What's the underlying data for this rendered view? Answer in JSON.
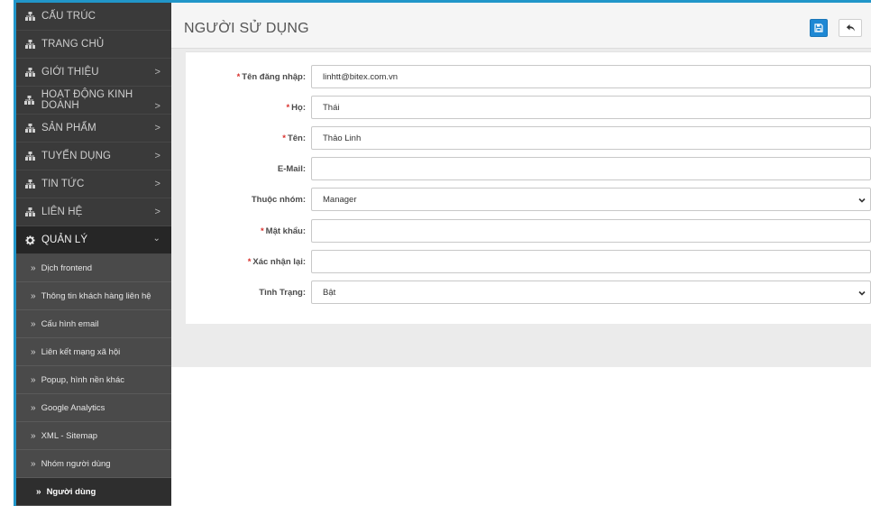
{
  "sidebar": {
    "items": [
      {
        "label": "CẤU TRÚC",
        "chevron": ""
      },
      {
        "label": "TRANG CHỦ",
        "chevron": ""
      },
      {
        "label": "GIỚI THIỆU",
        "chevron": ">"
      },
      {
        "label": "HOẠT ĐỘNG KINH DOANH",
        "chevron": ">"
      },
      {
        "label": "SẢN PHẨM",
        "chevron": ">"
      },
      {
        "label": "TUYỂN DỤNG",
        "chevron": ">"
      },
      {
        "label": "TIN TỨC",
        "chevron": ">"
      },
      {
        "label": "LIÊN HỆ",
        "chevron": ">"
      },
      {
        "label": "QUẢN LÝ",
        "chevron": "⌄"
      }
    ],
    "sub_marker": "»",
    "sub_items": [
      {
        "label": "Dịch frontend"
      },
      {
        "label": "Thông tin khách hàng liên hệ"
      },
      {
        "label": "Cấu hình email"
      },
      {
        "label": "Liên kết mạng xã hội"
      },
      {
        "label": "Popup, hình nền khác"
      },
      {
        "label": "Google Analytics"
      },
      {
        "label": "XML - Sitemap"
      },
      {
        "label": "Nhóm người dùng"
      },
      {
        "label": "Người dùng"
      }
    ]
  },
  "header": {
    "title": "NGƯỜI SỬ DỤNG"
  },
  "form": {
    "required_marker": "*",
    "fields": [
      {
        "label": "Tên đăng nhập:",
        "value": "linhtt@bitex.com.vn"
      },
      {
        "label": "Họ:",
        "value": "Thái"
      },
      {
        "label": "Tên:",
        "value": "Thảo Linh"
      },
      {
        "label": "E-Mail:",
        "value": ""
      },
      {
        "label": "Thuộc nhóm:",
        "value": "Manager"
      },
      {
        "label": "Mật khẩu:",
        "value": ""
      },
      {
        "label": "Xác nhận lại:",
        "value": ""
      },
      {
        "label": "Tình Trạng:",
        "value": "Bật"
      }
    ]
  },
  "colors": {
    "accent": "#1e88d4",
    "sidebar_bg": "#3a3a3a",
    "required": "#d9302c"
  }
}
